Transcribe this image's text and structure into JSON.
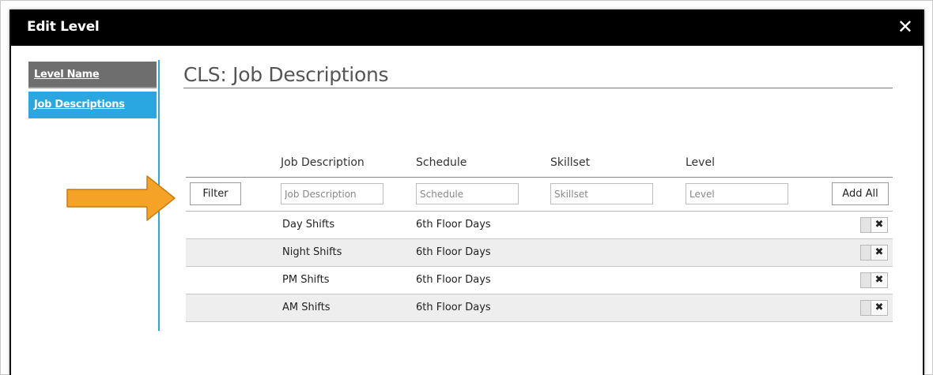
{
  "dialog": {
    "title": "Edit Level",
    "close_glyph": "✕"
  },
  "nav": {
    "items": [
      {
        "label": "Level Name",
        "active": false
      },
      {
        "label": "Job Descriptions",
        "active": true
      }
    ]
  },
  "main": {
    "title": "CLS: Job Descriptions"
  },
  "grid": {
    "headers": [
      "Job Description",
      "Schedule",
      "Skillset",
      "Level"
    ],
    "filter_label": "Filter",
    "add_all_label": "Add All",
    "placeholders": {
      "job_description": "Job Description",
      "schedule": "Schedule",
      "skillset": "Skillset",
      "level": "Level"
    },
    "rows": [
      {
        "job_description": "Day Shifts",
        "schedule": "6th Floor Days",
        "skillset": "",
        "level": ""
      },
      {
        "job_description": "Night Shifts",
        "schedule": "6th Floor Days",
        "skillset": "",
        "level": ""
      },
      {
        "job_description": "PM Shifts",
        "schedule": "6th Floor Days",
        "skillset": "",
        "level": ""
      },
      {
        "job_description": "AM Shifts",
        "schedule": "6th Floor Days",
        "skillset": "",
        "level": ""
      }
    ],
    "delete_glyph": "✖"
  },
  "colors": {
    "titlebar": "#000000",
    "nav_active": "#2aa7e0",
    "nav_inactive": "#6e6e6e",
    "arrow": "#f5a326",
    "row_alt": "#eeeeee"
  },
  "icons": {
    "close": "close-icon",
    "delete": "delete-icon",
    "arrow": "arrow-right-icon"
  }
}
